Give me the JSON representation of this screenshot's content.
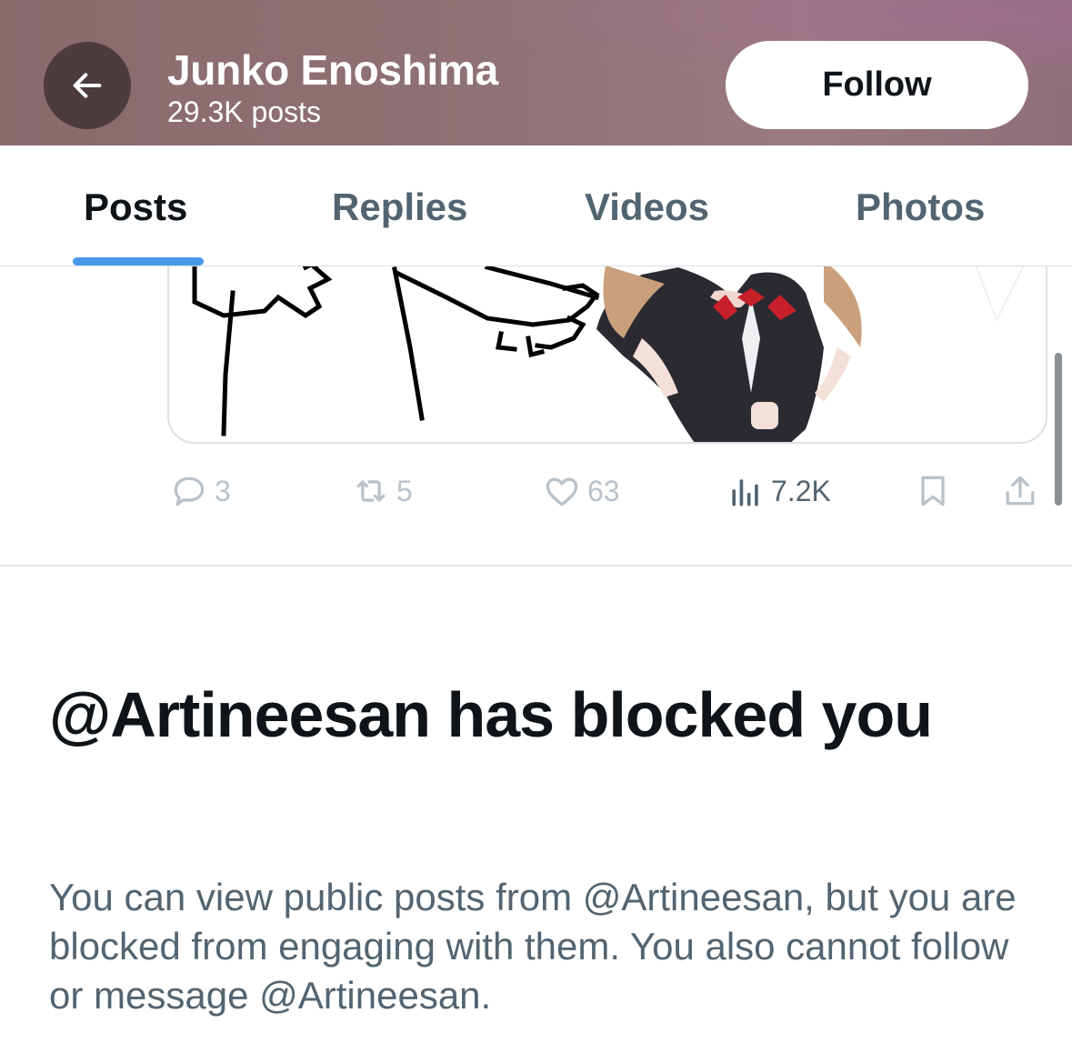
{
  "header": {
    "profile_name": "Junko Enoshima",
    "post_count": "29.3K posts",
    "follow_label": "Follow",
    "back_icon": "arrow-left-icon"
  },
  "tabs": [
    {
      "label": "Posts",
      "active": true
    },
    {
      "label": "Replies",
      "active": false
    },
    {
      "label": "Videos",
      "active": false
    },
    {
      "label": "Photos",
      "active": false
    }
  ],
  "post": {
    "media_description_icon": "media-image",
    "actions": {
      "replies": "3",
      "reposts": "5",
      "likes": "63",
      "views": "7.2K"
    }
  },
  "blocked": {
    "title": "@Artineesan has blocked you",
    "description": "You can view public posts from @Artineesan, but you are blocked from engaging with them. You also cannot follow or message @Artineesan."
  },
  "colors": {
    "header_bg": "#8f7275",
    "accent": "#4a99e9",
    "text_primary": "#0f1419",
    "text_secondary": "#536471"
  }
}
